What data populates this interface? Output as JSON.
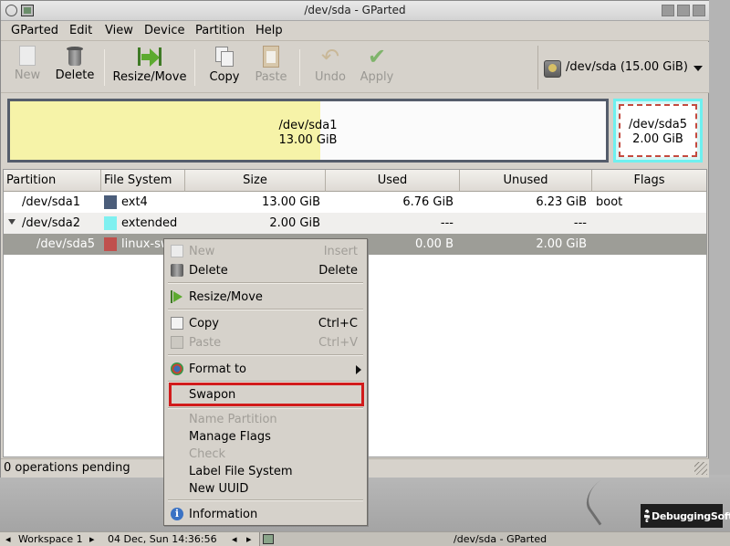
{
  "window": {
    "title": "/dev/sda - GParted"
  },
  "menubar": [
    "GParted",
    "Edit",
    "View",
    "Device",
    "Partition",
    "Help"
  ],
  "toolbar": {
    "new": "New",
    "delete": "Delete",
    "resize": "Resize/Move",
    "copy": "Copy",
    "paste": "Paste",
    "undo": "Undo",
    "apply": "Apply"
  },
  "device": {
    "label": "/dev/sda  (15.00 GiB)"
  },
  "graphic": {
    "p1": {
      "name": "/dev/sda1",
      "size": "13.00 GiB",
      "used_fraction": 0.52
    },
    "p2": {
      "name": "/dev/sda5",
      "size": "2.00 GiB"
    }
  },
  "columns": [
    "Partition",
    "File System",
    "Size",
    "Used",
    "Unused",
    "Flags"
  ],
  "rows": [
    {
      "partition": "/dev/sda1",
      "fs": "ext4",
      "color": "#4b5d7a",
      "size": "13.00 GiB",
      "used": "6.76 GiB",
      "unused": "6.23 GiB",
      "flags": "boot"
    },
    {
      "partition": "/dev/sda2",
      "fs": "extended",
      "color": "#7ff0f0",
      "size": "2.00 GiB",
      "used": "---",
      "unused": "---",
      "flags": ""
    },
    {
      "partition": "/dev/sda5",
      "fs": "linux-swap",
      "fs_visible": "linux-sw",
      "color": "#c0504d",
      "size": "",
      "used": "0.00 B",
      "unused": "2.00 GiB",
      "flags": ""
    }
  ],
  "status": "0 operations pending",
  "context_menu": {
    "new": "New",
    "new_acc": "Insert",
    "delete": "Delete",
    "delete_acc": "Delete",
    "resize": "Resize/Move",
    "copy": "Copy",
    "copy_acc": "Ctrl+C",
    "paste": "Paste",
    "paste_acc": "Ctrl+V",
    "format": "Format to",
    "swapon": "Swapon",
    "name_partition": "Name Partition",
    "manage_flags": "Manage Flags",
    "check": "Check",
    "label_fs": "Label File System",
    "new_uuid": "New UUID",
    "information": "Information"
  },
  "taskbar": {
    "workspace": "Workspace 1",
    "clock": "04 Dec, Sun 14:36:56",
    "task": "/dev/sda - GParted"
  },
  "logo": "DebuggingSoft",
  "colors": {
    "highlight": "#d11b1b",
    "selected_row": "#9d9d97"
  }
}
